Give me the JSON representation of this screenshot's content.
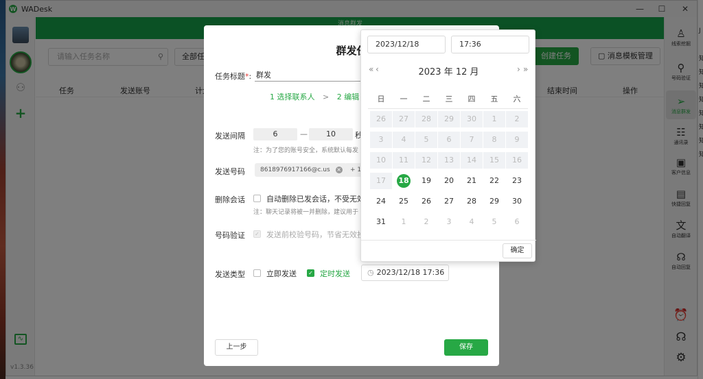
{
  "app": {
    "title": "WADesk",
    "version": "v1.3.36"
  },
  "colors": {
    "accent": "#27a845"
  },
  "left_sidebar": {
    "icons": [
      "avatar",
      "avatar-active",
      "user-icon",
      "plus-icon",
      "chart-icon"
    ]
  },
  "right_sidebar": {
    "items": [
      {
        "label": "线索挖掘",
        "icon": "person-icon"
      },
      {
        "label": "号码验证",
        "icon": "search-user-icon"
      },
      {
        "label": "消息群发",
        "icon": "send-icon",
        "active": true
      },
      {
        "label": "通讯录",
        "icon": "contacts-icon"
      },
      {
        "label": "客户信息",
        "icon": "customer-card-icon"
      },
      {
        "label": "快捷回复",
        "icon": "chat-icon"
      },
      {
        "label": "自动翻译",
        "icon": "translate-icon"
      },
      {
        "label": "自动回复",
        "icon": "headset-bubble-icon"
      }
    ],
    "bottom_icons": [
      "alarm-icon",
      "headset-icon",
      "settings-icon"
    ]
  },
  "main": {
    "banner": "消息群发",
    "search_placeholder": "请输入任务名称",
    "filter_label": "全部任",
    "create_button": "创建任务",
    "template_button": "消息模板管理",
    "table_headers": [
      "任务",
      "发送账号",
      "计划",
      "结束时间",
      "操作"
    ]
  },
  "dialog": {
    "title": "群发任",
    "task_title_label": "任务标题",
    "task_title_required": "*",
    "task_title_value": "群发",
    "step1": "1 选择联系人",
    "step_sep": ">",
    "step2": "2 编辑",
    "interval_label": "发送间隔",
    "interval_min": "6",
    "interval_dash": "—",
    "interval_max": "10",
    "interval_unit": "秒",
    "interval_note": "注：为了您的账号安全，系统默认每发",
    "sender_label": "发送号码",
    "sender_tag": "8618976917166@c.us",
    "sender_more": "+ 1",
    "delete_label": "删除会话",
    "delete_text": "自动删除已发会话，不受无效",
    "delete_note": "注：聊天记录将被一并删除，建议用于",
    "verify_label": "号码验证",
    "verify_text": "发送前校验号码，节省无效投",
    "send_type_label": "发送类型",
    "immediate_label": "立即发送",
    "scheduled_label": "定时发送",
    "scheduled_value": "2023/12/18 17:36",
    "prev_button": "上一步",
    "save_button": "保存"
  },
  "datepicker": {
    "date_input": "2023/12/18",
    "time_input": "17:36",
    "year_month": "2023 年  12 月",
    "prev_year": "«",
    "prev_month": "‹",
    "next_month": "›",
    "next_year": "»",
    "weekdays": [
      "日",
      "一",
      "二",
      "三",
      "四",
      "五",
      "六"
    ],
    "weeks": [
      [
        {
          "d": "26",
          "s": "dis"
        },
        {
          "d": "27",
          "s": "dis"
        },
        {
          "d": "28",
          "s": "dis"
        },
        {
          "d": "29",
          "s": "dis"
        },
        {
          "d": "30",
          "s": "dis"
        },
        {
          "d": "1",
          "s": "dis"
        },
        {
          "d": "2",
          "s": "dis"
        }
      ],
      [
        {
          "d": "3",
          "s": "dis"
        },
        {
          "d": "4",
          "s": "dis"
        },
        {
          "d": "5",
          "s": "dis"
        },
        {
          "d": "6",
          "s": "dis"
        },
        {
          "d": "7",
          "s": "dis"
        },
        {
          "d": "8",
          "s": "dis"
        },
        {
          "d": "9",
          "s": "dis"
        }
      ],
      [
        {
          "d": "10",
          "s": "dis"
        },
        {
          "d": "11",
          "s": "dis"
        },
        {
          "d": "12",
          "s": "dis"
        },
        {
          "d": "13",
          "s": "dis"
        },
        {
          "d": "14",
          "s": "dis"
        },
        {
          "d": "15",
          "s": "dis"
        },
        {
          "d": "16",
          "s": "dis"
        }
      ],
      [
        {
          "d": "17",
          "s": "dis"
        },
        {
          "d": "18",
          "s": "today"
        },
        {
          "d": "19",
          "s": ""
        },
        {
          "d": "20",
          "s": ""
        },
        {
          "d": "21",
          "s": ""
        },
        {
          "d": "22",
          "s": ""
        },
        {
          "d": "23",
          "s": ""
        }
      ],
      [
        {
          "d": "24",
          "s": ""
        },
        {
          "d": "25",
          "s": ""
        },
        {
          "d": "26",
          "s": ""
        },
        {
          "d": "27",
          "s": ""
        },
        {
          "d": "28",
          "s": ""
        },
        {
          "d": "29",
          "s": ""
        },
        {
          "d": "30",
          "s": ""
        }
      ],
      [
        {
          "d": "31",
          "s": ""
        },
        {
          "d": "1",
          "s": "gray"
        },
        {
          "d": "2",
          "s": "gray"
        },
        {
          "d": "3",
          "s": "gray"
        },
        {
          "d": "4",
          "s": "gray"
        },
        {
          "d": "5",
          "s": "gray"
        },
        {
          "d": "6",
          "s": "gray"
        }
      ]
    ],
    "ok_button": "确定"
  }
}
